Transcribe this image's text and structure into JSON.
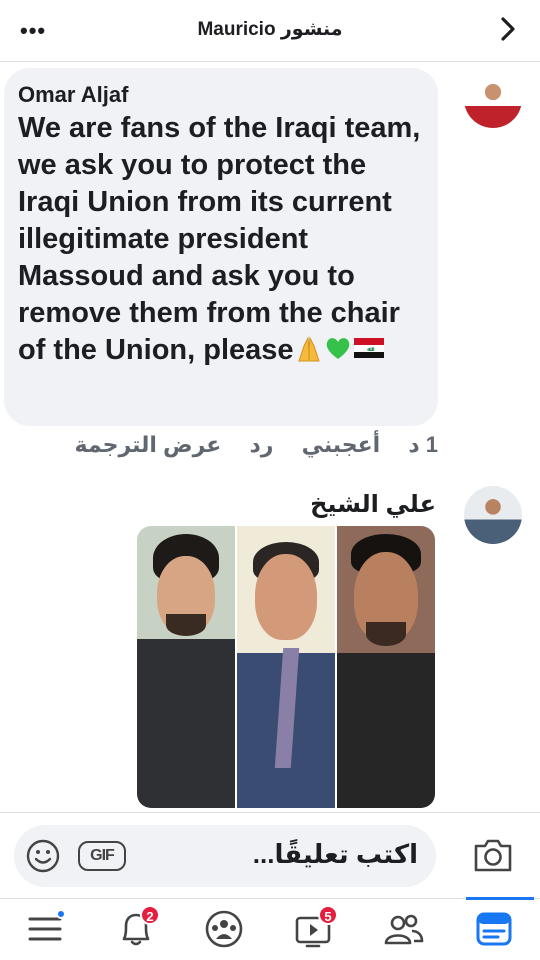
{
  "header": {
    "title": "Mauricio منشور",
    "more_icon": "more-horizontal-icon",
    "forward_icon": "chevron-right-icon"
  },
  "comment1": {
    "author": "Omar Aljaf",
    "text": "We are fans of the Iraqi team, we ask you to protect the Iraqi Union from its current illegitimate president Massoud and ask you to remove them from the chair of the Union, please",
    "emojis": [
      "folded-hands",
      "green-heart",
      "iraq-flag"
    ],
    "actions": {
      "time": "1 د",
      "like": "أعجبني",
      "reply": "رد",
      "translate": "عرض الترجمة"
    }
  },
  "comment2": {
    "author": "علي الشيخ"
  },
  "composer": {
    "placeholder": "اكتب تعليقًا...",
    "gif_label": "GIF",
    "emoji_icon": "smiley-icon",
    "camera_icon": "camera-icon"
  },
  "nav": {
    "items": [
      "menu",
      "notifications",
      "groups",
      "watch",
      "friends",
      "feed"
    ],
    "notifications_badge": "2",
    "watch_badge": "5",
    "active": "feed",
    "accent": "#1877f2"
  },
  "colors": {
    "bubble": "#f0f2f5",
    "badge": "#e41e3f",
    "muted_text": "#606770"
  }
}
